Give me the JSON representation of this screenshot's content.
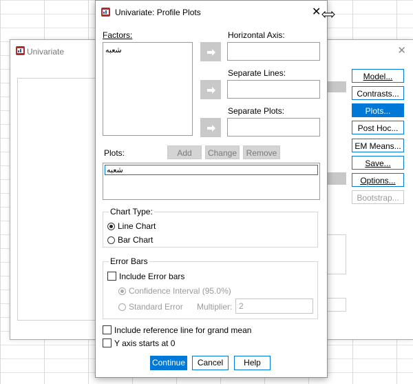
{
  "background_window": {
    "title": "Univariate",
    "buttons": [
      {
        "label": "Model...",
        "accel": "M",
        "state": "normal"
      },
      {
        "label": "Contrasts...",
        "accel": "n",
        "state": "normal"
      },
      {
        "label": "Plots...",
        "accel": "T",
        "state": "active"
      },
      {
        "label": "Post Hoc...",
        "accel": "H",
        "state": "normal"
      },
      {
        "label": "EM Means...",
        "accel": "E",
        "state": "normal"
      },
      {
        "label": "Save...",
        "accel": "S",
        "state": "normal"
      },
      {
        "label": "Options...",
        "accel": "O",
        "state": "normal"
      },
      {
        "label": "Bootstrap...",
        "accel": "B",
        "state": "disabled"
      }
    ]
  },
  "dialog": {
    "title": "Univariate: Profile Plots",
    "factors_label": "Factors:",
    "factors_items": [
      "شعبه"
    ],
    "horizontal_axis_label": "Horizontal Axis:",
    "horizontal_axis_value": "",
    "separate_lines_label": "Separate Lines:",
    "separate_lines_value": "",
    "separate_plots_label": "Separate Plots:",
    "separate_plots_value": "",
    "plots_label": "Plots:",
    "add_label": "Add",
    "change_label": "Change",
    "remove_label": "Remove",
    "plots_items": [
      "شعبه"
    ],
    "chart_type": {
      "title": "Chart Type:",
      "line_label": "Line Chart",
      "bar_label": "Bar Chart",
      "selected": "Line Chart"
    },
    "error_bars": {
      "title": "Error Bars",
      "include_label": "Include Error bars",
      "include_checked": false,
      "ci_label": "Confidence Interval (95.0%)",
      "se_label": "Standard Error",
      "multiplier_label": "Multiplier:",
      "multiplier_value": "2"
    },
    "ref_line_label": "Include reference line for grand mean",
    "ref_line_checked": false,
    "y_axis_label": "Y axis starts at 0",
    "y_axis_checked": false,
    "continue_label": "Continue",
    "cancel_label": "Cancel",
    "help_label": "Help"
  },
  "colors": {
    "accent": "#0078d7",
    "disabled_text": "#9a9a9a",
    "arrow_button": "#c9c9c9"
  }
}
